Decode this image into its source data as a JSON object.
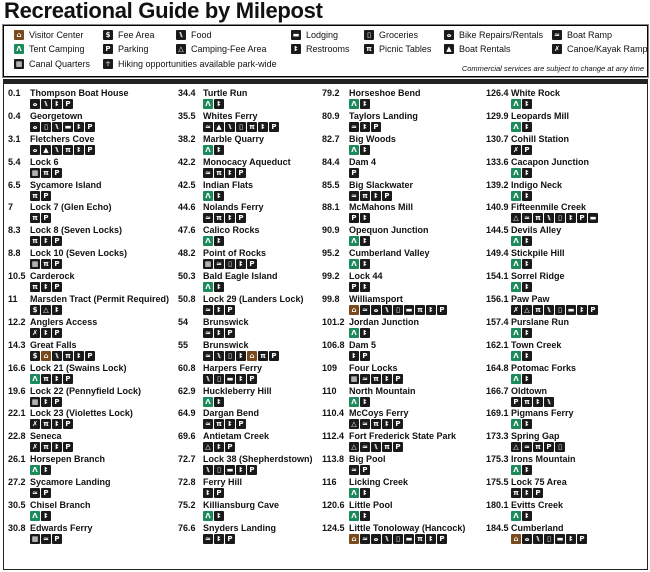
{
  "title": "Recreational Guide by Milepost",
  "colors": {
    "tent": "#1d8a5c",
    "visitor": "#7a4a1c",
    "icon": "#1a1a1a"
  },
  "icon_map": {
    "visitor": {
      "glyph": "⌂",
      "cls": "brown",
      "name": "visitor-center-icon"
    },
    "tent": {
      "glyph": "Λ",
      "cls": "green",
      "name": "tent-camping-icon"
    },
    "quarters": {
      "glyph": "▦",
      "cls": "",
      "name": "canal-quarters-icon"
    },
    "fee": {
      "glyph": "$",
      "cls": "",
      "name": "fee-area-icon"
    },
    "parking": {
      "glyph": "P",
      "cls": "",
      "name": "parking-icon"
    },
    "hiking": {
      "glyph": "☥",
      "cls": "",
      "name": "hiking-icon"
    },
    "food": {
      "glyph": "⑊",
      "cls": "",
      "name": "food-icon"
    },
    "campfee": {
      "glyph": "△",
      "cls": "",
      "name": "camping-fee-area-icon"
    },
    "lodging": {
      "glyph": "▬",
      "cls": "",
      "name": "lodging-icon"
    },
    "restrooms": {
      "glyph": "ꔪ",
      "cls": "",
      "name": "restrooms-icon"
    },
    "groceries": {
      "glyph": "▯",
      "cls": "",
      "name": "groceries-icon"
    },
    "picnic": {
      "glyph": "π",
      "cls": "",
      "name": "picnic-tables-icon"
    },
    "bike": {
      "glyph": "ⴰ",
      "cls": "",
      "name": "bike-repairs-icon"
    },
    "boatrental": {
      "glyph": "▲",
      "cls": "",
      "name": "boat-rentals-icon"
    },
    "boatramp": {
      "glyph": "≃",
      "cls": "",
      "name": "boat-ramp-icon"
    },
    "canoe": {
      "glyph": "✗",
      "cls": "",
      "name": "canoe-kayak-ramp-icon"
    }
  },
  "legend": {
    "items": [
      {
        "icon": "visitor",
        "label": "Visitor Center"
      },
      {
        "icon": "tent",
        "label": "Tent Camping"
      },
      {
        "icon": "quarters",
        "label": "Canal Quarters"
      },
      {
        "icon": "fee",
        "label": "Fee Area"
      },
      {
        "icon": "parking",
        "label": "Parking"
      },
      {
        "icon": "hiking",
        "label": "Hiking opportunities available park-wide"
      },
      {
        "icon": "food",
        "label": "Food"
      },
      {
        "icon": "campfee",
        "label": "Camping-Fee Area"
      },
      {
        "icon": "lodging",
        "label": "Lodging"
      },
      {
        "icon": "restrooms",
        "label": "Restrooms"
      },
      {
        "icon": "groceries",
        "label": "Groceries"
      },
      {
        "icon": "picnic",
        "label": "Picnic Tables"
      },
      {
        "icon": "bike",
        "label": "Bike Repairs/Rentals"
      },
      {
        "icon": "boatrental",
        "label": "Boat Rentals"
      },
      {
        "icon": "boatramp",
        "label": "Boat Ramp"
      },
      {
        "icon": "canoe",
        "label": "Canoe/Kayak Ramp"
      }
    ],
    "note": "Commercial services are subject to change at any time"
  },
  "columns": [
    [
      {
        "mp": "0.1",
        "name": "Thompson Boat House",
        "icons": [
          "bike",
          "food",
          "restrooms",
          "parking"
        ]
      },
      {
        "mp": "0.4",
        "name": "Georgetown",
        "icons": [
          "bike",
          "groceries",
          "food",
          "lodging",
          "restrooms",
          "parking"
        ]
      },
      {
        "mp": "3.1",
        "name": "Fletchers Cove",
        "icons": [
          "bike",
          "boatrental",
          "food",
          "picnic",
          "restrooms",
          "parking"
        ]
      },
      {
        "mp": "5.4",
        "name": "Lock 6",
        "icons": [
          "quarters",
          "picnic",
          "parking"
        ]
      },
      {
        "mp": "6.5",
        "name": "Sycamore Island",
        "icons": [
          "picnic",
          "parking"
        ]
      },
      {
        "mp": "7",
        "name": "Lock 7 (Glen Echo)",
        "icons": [
          "picnic",
          "parking"
        ]
      },
      {
        "mp": "8.3",
        "name": "Lock 8 (Seven Locks)",
        "icons": [
          "picnic",
          "restrooms",
          "parking"
        ]
      },
      {
        "mp": "8.8",
        "name": "Lock 10 (Seven Locks)",
        "icons": [
          "quarters",
          "picnic",
          "parking"
        ]
      },
      {
        "mp": "10.5",
        "name": "Carderock",
        "icons": [
          "picnic",
          "restrooms",
          "parking"
        ]
      },
      {
        "mp": "11",
        "name": "Marsden Tract (Permit Required)",
        "icons": [
          "fee",
          "campfee",
          "restrooms"
        ]
      },
      {
        "mp": "12.2",
        "name": "Anglers Access",
        "icons": [
          "canoe",
          "restrooms",
          "parking"
        ]
      },
      {
        "mp": "14.3",
        "name": "Great Falls",
        "icons": [
          "fee",
          "visitor",
          "food",
          "picnic",
          "restrooms",
          "parking"
        ]
      },
      {
        "mp": "16.6",
        "name": "Lock 21 (Swains Lock)",
        "icons": [
          "tent",
          "picnic",
          "restrooms",
          "parking"
        ]
      },
      {
        "mp": "19.6",
        "name": "Lock 22 (Pennyfield Lock)",
        "icons": [
          "quarters",
          "restrooms",
          "parking"
        ]
      },
      {
        "mp": "22.1",
        "name": "Lock 23 (Violettes Lock)",
        "icons": [
          "canoe",
          "picnic",
          "restrooms",
          "parking"
        ]
      },
      {
        "mp": "22.8",
        "name": "Seneca",
        "icons": [
          "canoe",
          "picnic",
          "restrooms",
          "parking"
        ]
      },
      {
        "mp": "26.1",
        "name": "Horsepen Branch",
        "icons": [
          "tent",
          "restrooms"
        ]
      },
      {
        "mp": "27.2",
        "name": "Sycamore Landing",
        "icons": [
          "boatramp",
          "parking"
        ]
      },
      {
        "mp": "30.5",
        "name": "Chisel Branch",
        "icons": [
          "tent",
          "restrooms"
        ]
      },
      {
        "mp": "30.8",
        "name": "Edwards Ferry",
        "icons": [
          "quarters",
          "boatramp",
          "parking"
        ]
      }
    ],
    [
      {
        "mp": "34.4",
        "name": "Turtle Run",
        "icons": [
          "tent",
          "restrooms"
        ]
      },
      {
        "mp": "35.5",
        "name": "Whites Ferry",
        "icons": [
          "boatramp",
          "boatrental",
          "food",
          "groceries",
          "picnic",
          "restrooms",
          "parking"
        ]
      },
      {
        "mp": "38.2",
        "name": "Marble Quarry",
        "icons": [
          "tent",
          "restrooms"
        ]
      },
      {
        "mp": "42.2",
        "name": "Monocacy Aqueduct",
        "icons": [
          "boatramp",
          "picnic",
          "restrooms",
          "parking"
        ]
      },
      {
        "mp": "42.5",
        "name": "Indian Flats",
        "icons": [
          "tent",
          "restrooms"
        ]
      },
      {
        "mp": "44.6",
        "name": "Nolands Ferry",
        "icons": [
          "boatramp",
          "picnic",
          "restrooms",
          "parking"
        ]
      },
      {
        "mp": "47.6",
        "name": "Calico Rocks",
        "icons": [
          "tent",
          "restrooms"
        ]
      },
      {
        "mp": "48.2",
        "name": "Point of Rocks",
        "icons": [
          "quarters",
          "boatramp",
          "groceries",
          "restrooms",
          "parking"
        ]
      },
      {
        "mp": "50.3",
        "name": "Bald Eagle Island",
        "icons": [
          "tent",
          "restrooms"
        ]
      },
      {
        "mp": "50.8",
        "name": "Lock 29 (Landers Lock)",
        "icons": [
          "boatramp",
          "restrooms",
          "parking"
        ]
      },
      {
        "mp": "54",
        "name": "Brunswick",
        "icons": [
          "boatramp",
          "restrooms",
          "parking"
        ]
      },
      {
        "mp": "55",
        "name": "Brunswick",
        "icons": [
          "boatramp",
          "food",
          "groceries",
          "restrooms",
          "visitor",
          "picnic",
          "parking"
        ]
      },
      {
        "mp": "60.8",
        "name": "Harpers Ferry",
        "icons": [
          "food",
          "groceries",
          "lodging",
          "restrooms",
          "parking"
        ]
      },
      {
        "mp": "62.9",
        "name": "Huckleberry Hill",
        "icons": [
          "tent",
          "restrooms"
        ]
      },
      {
        "mp": "64.9",
        "name": "Dargan Bend",
        "icons": [
          "boatramp",
          "picnic",
          "restrooms",
          "parking"
        ]
      },
      {
        "mp": "69.6",
        "name": "Antietam Creek",
        "icons": [
          "campfee",
          "restrooms",
          "parking"
        ]
      },
      {
        "mp": "72.7",
        "name": "Lock 38 (Shepherdstown)",
        "icons": [
          "food",
          "groceries",
          "lodging",
          "restrooms",
          "parking"
        ]
      },
      {
        "mp": "72.8",
        "name": "Ferry Hill",
        "icons": [
          "restrooms",
          "parking"
        ]
      },
      {
        "mp": "75.2",
        "name": "Killiansburg Cave",
        "icons": [
          "tent",
          "restrooms"
        ]
      },
      {
        "mp": "76.6",
        "name": "Snyders Landing",
        "icons": [
          "boatramp",
          "restrooms",
          "parking"
        ]
      }
    ],
    [
      {
        "mp": "79.2",
        "name": "Horseshoe Bend",
        "icons": [
          "tent",
          "restrooms"
        ]
      },
      {
        "mp": "80.9",
        "name": "Taylors Landing",
        "icons": [
          "boatramp",
          "restrooms",
          "parking"
        ]
      },
      {
        "mp": "82.7",
        "name": "Big Woods",
        "icons": [
          "tent",
          "restrooms"
        ]
      },
      {
        "mp": "84.4",
        "name": "Dam 4",
        "icons": [
          "parking"
        ]
      },
      {
        "mp": "85.5",
        "name": "Big Slackwater",
        "icons": [
          "boatramp",
          "picnic",
          "restrooms",
          "parking"
        ]
      },
      {
        "mp": "88.1",
        "name": "McMahons Mill",
        "icons": [
          "parking",
          "restrooms"
        ]
      },
      {
        "mp": "90.9",
        "name": "Opequon Junction",
        "icons": [
          "tent",
          "restrooms"
        ]
      },
      {
        "mp": "95.2",
        "name": "Cumberland Valley",
        "icons": [
          "tent",
          "restrooms"
        ]
      },
      {
        "mp": "99.2",
        "name": "Lock 44",
        "icons": [
          "parking",
          "restrooms"
        ]
      },
      {
        "mp": "99.8",
        "name": "Williamsport",
        "icons": [
          "visitor",
          "boatramp",
          "bike",
          "food",
          "groceries",
          "lodging",
          "picnic",
          "restrooms",
          "parking"
        ]
      },
      {
        "mp": "101.2",
        "name": "Jordan Junction",
        "icons": [
          "tent",
          "restrooms"
        ]
      },
      {
        "mp": "106.8",
        "name": "Dam 5",
        "icons": [
          "restrooms",
          "parking"
        ]
      },
      {
        "mp": "109",
        "name": "Four Locks",
        "icons": [
          "quarters",
          "boatramp",
          "picnic",
          "restrooms",
          "parking"
        ]
      },
      {
        "mp": "110",
        "name": "North Mountain",
        "icons": [
          "tent",
          "restrooms"
        ]
      },
      {
        "mp": "110.4",
        "name": "McCoys Ferry",
        "icons": [
          "campfee",
          "boatramp",
          "picnic",
          "restrooms",
          "parking"
        ]
      },
      {
        "mp": "112.4",
        "name": "Fort Frederick State Park",
        "icons": [
          "campfee",
          "boatramp",
          "food",
          "picnic",
          "parking"
        ]
      },
      {
        "mp": "113.8",
        "name": "Big Pool",
        "icons": [
          "boatramp",
          "parking"
        ]
      },
      {
        "mp": "116",
        "name": "Licking Creek",
        "icons": [
          "tent",
          "restrooms"
        ]
      },
      {
        "mp": "120.6",
        "name": "Little Pool",
        "icons": [
          "tent",
          "restrooms"
        ]
      },
      {
        "mp": "124.5",
        "name": "Little Tonoloway (Hancock)",
        "icons": [
          "visitor",
          "boatramp",
          "bike",
          "food",
          "groceries",
          "lodging",
          "picnic",
          "restrooms",
          "parking"
        ]
      }
    ],
    [
      {
        "mp": "126.4",
        "name": "White Rock",
        "icons": [
          "tent",
          "restrooms"
        ]
      },
      {
        "mp": "129.9",
        "name": "Leopards Mill",
        "icons": [
          "tent",
          "restrooms"
        ]
      },
      {
        "mp": "130.7",
        "name": "Cohill Station",
        "icons": [
          "canoe",
          "parking"
        ]
      },
      {
        "mp": "133.6",
        "name": "Cacapon Junction",
        "icons": [
          "tent",
          "restrooms"
        ]
      },
      {
        "mp": "139.2",
        "name": "Indigo Neck",
        "icons": [
          "tent",
          "restrooms"
        ]
      },
      {
        "mp": "140.9",
        "name": "Fifteenmile Creek",
        "icons": [
          "campfee",
          "boatramp",
          "picnic",
          "food",
          "groceries",
          "restrooms",
          "parking",
          "lodging"
        ]
      },
      {
        "mp": "144.5",
        "name": "Devils Alley",
        "icons": [
          "tent",
          "restrooms"
        ]
      },
      {
        "mp": "149.4",
        "name": "Stickpile Hill",
        "icons": [
          "tent",
          "restrooms"
        ]
      },
      {
        "mp": "154.1",
        "name": "Sorrel Ridge",
        "icons": [
          "tent",
          "restrooms"
        ]
      },
      {
        "mp": "156.1",
        "name": "Paw Paw",
        "icons": [
          "canoe",
          "campfee",
          "picnic",
          "food",
          "groceries",
          "lodging",
          "restrooms",
          "parking"
        ]
      },
      {
        "mp": "157.4",
        "name": "Purslane Run",
        "icons": [
          "tent",
          "restrooms"
        ]
      },
      {
        "mp": "162.1",
        "name": "Town Creek",
        "icons": [
          "tent",
          "restrooms"
        ]
      },
      {
        "mp": "164.8",
        "name": "Potomac Forks",
        "icons": [
          "tent",
          "restrooms"
        ]
      },
      {
        "mp": "166.7",
        "name": "Oldtown",
        "icons": [
          "parking",
          "picnic",
          "restrooms",
          "food"
        ]
      },
      {
        "mp": "169.1",
        "name": "Pigmans Ferry",
        "icons": [
          "tent",
          "restrooms"
        ]
      },
      {
        "mp": "173.3",
        "name": "Spring Gap",
        "icons": [
          "campfee",
          "boatramp",
          "picnic",
          "parking",
          "groceries"
        ]
      },
      {
        "mp": "175.3",
        "name": "Irons Mountain",
        "icons": [
          "tent",
          "restrooms"
        ]
      },
      {
        "mp": "175.5",
        "name": "Lock 75 Area",
        "icons": [
          "picnic",
          "restrooms",
          "parking"
        ]
      },
      {
        "mp": "180.1",
        "name": "Evitts Creek",
        "icons": [
          "tent",
          "restrooms"
        ]
      },
      {
        "mp": "184.5",
        "name": "Cumberland",
        "icons": [
          "visitor",
          "bike",
          "food",
          "groceries",
          "lodging",
          "restrooms",
          "parking"
        ]
      }
    ]
  ]
}
